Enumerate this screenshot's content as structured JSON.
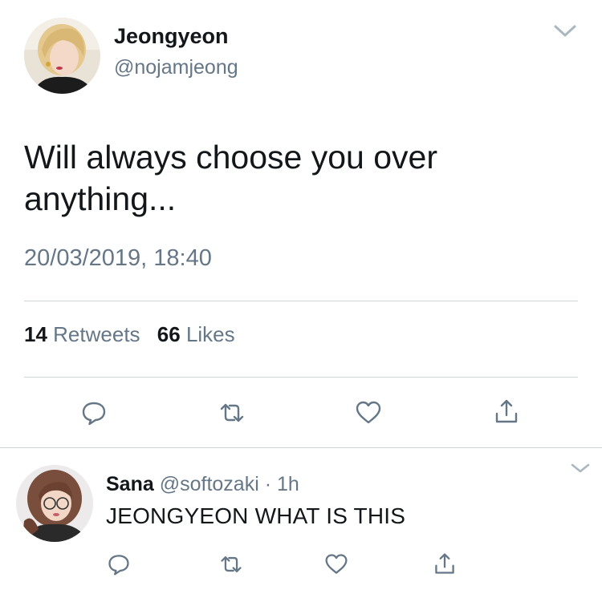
{
  "tweet": {
    "author_name": "Jeongyeon",
    "author_handle": "@nojamjeong",
    "text": "Will always choose you over anything...",
    "timestamp": "20/03/2019, 18:40",
    "retweet_count": "14",
    "retweet_label": "Retweets",
    "like_count": "66",
    "like_label": "Likes",
    "actions": [
      "reply-icon",
      "retweet-icon",
      "like-icon",
      "share-icon"
    ]
  },
  "reply": {
    "author_name": "Sana",
    "author_handle": "@softozaki",
    "separator": "·",
    "time": "1h",
    "text": "JEONGYEON WHAT IS THIS",
    "actions": [
      "reply-icon",
      "retweet-icon",
      "like-icon",
      "share-icon"
    ]
  },
  "colors": {
    "text_primary": "#14171a",
    "text_secondary": "#657786",
    "icon": "#657786",
    "divider": "#d0d5d9"
  }
}
